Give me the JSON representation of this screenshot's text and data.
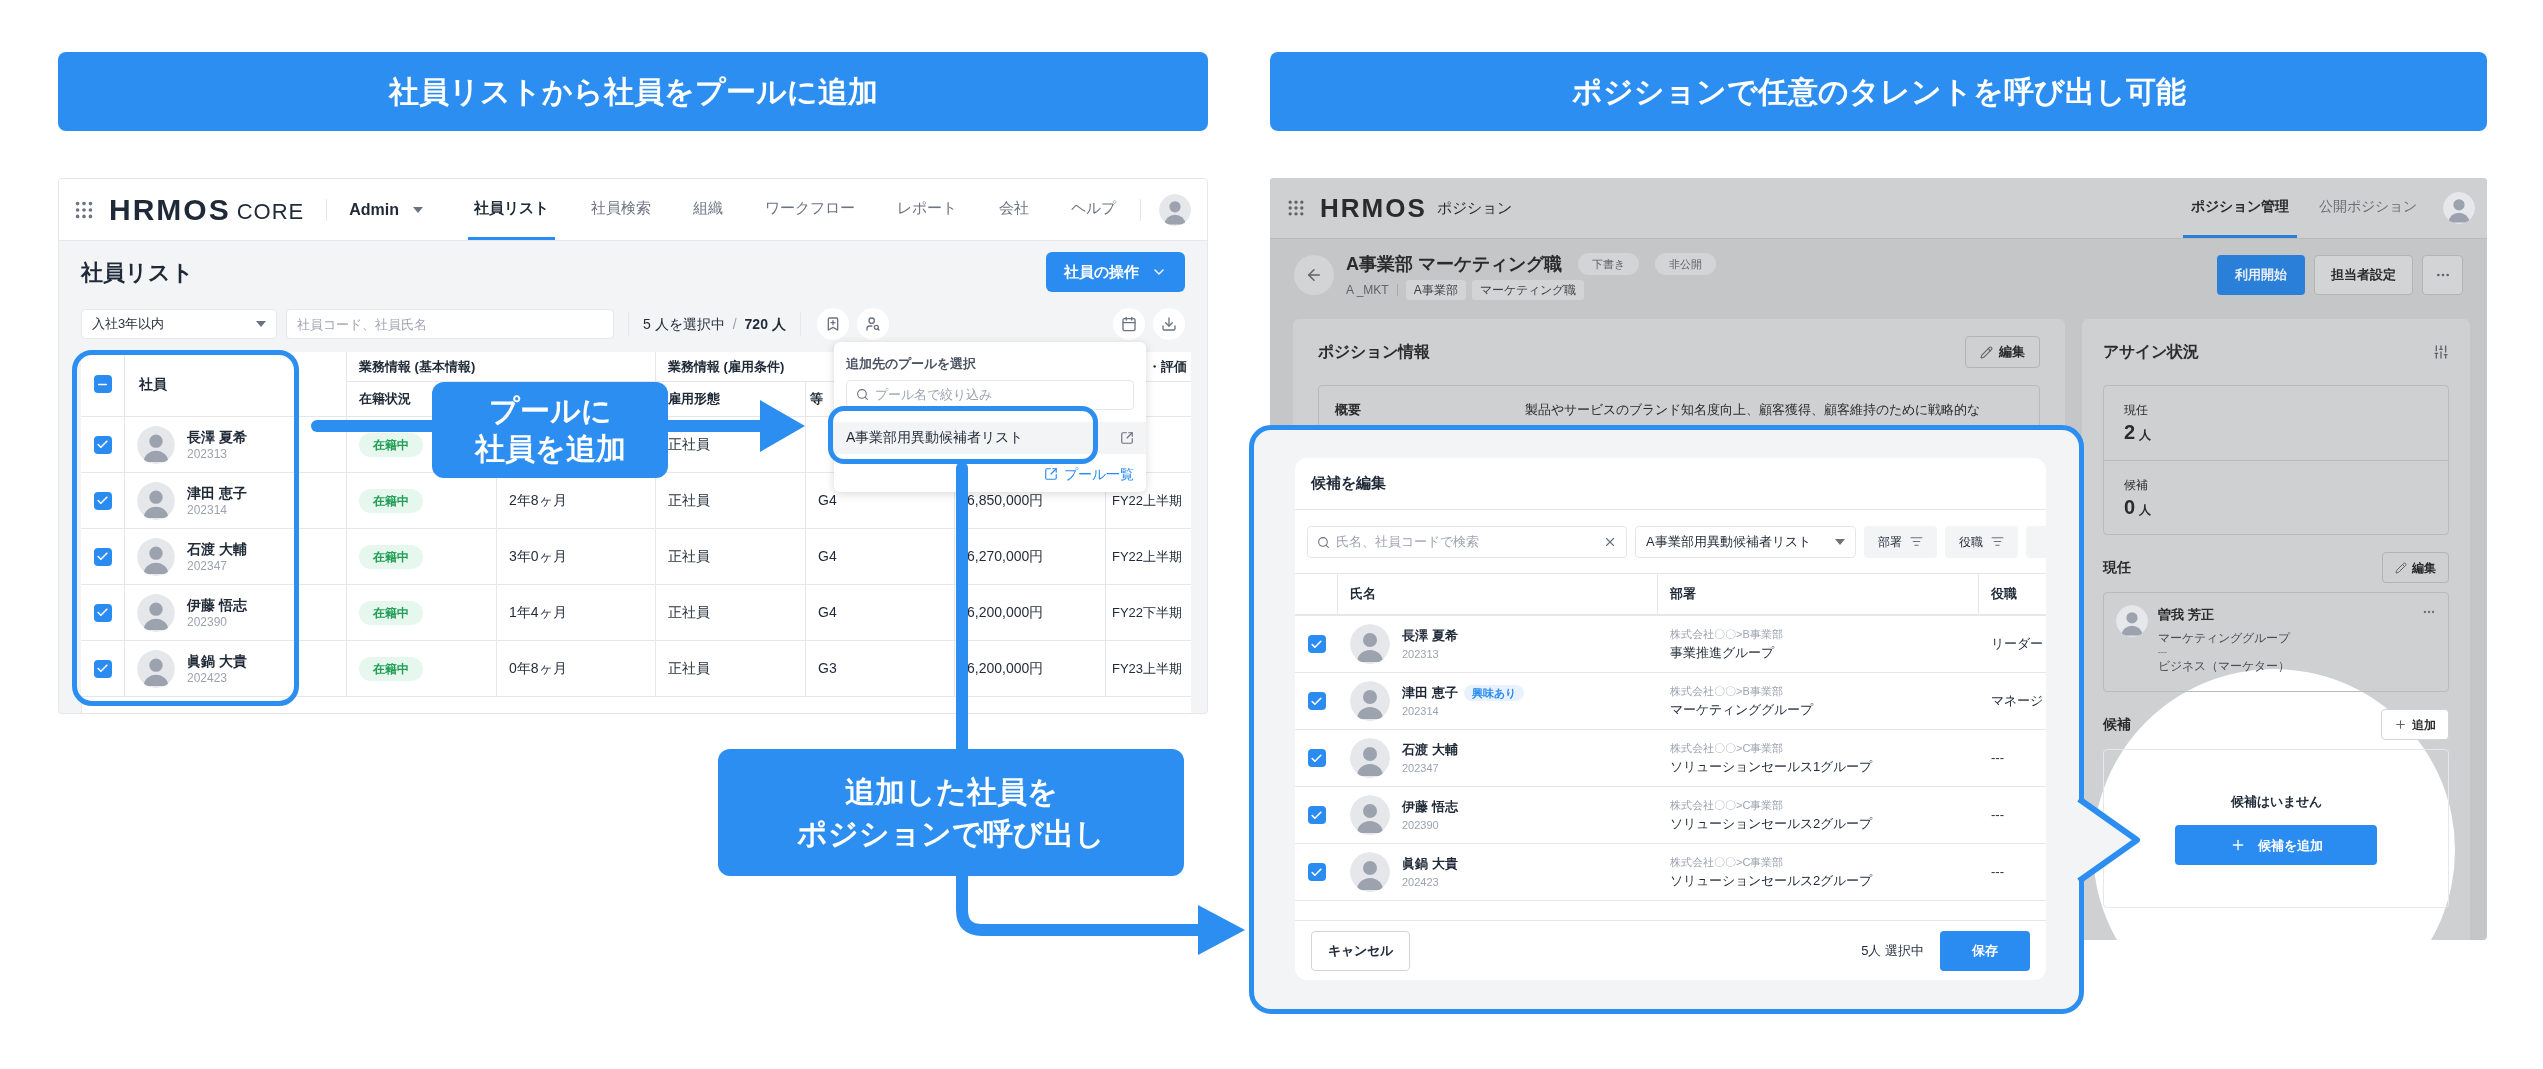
{
  "banners": [
    {
      "text": "社員リストから社員をプールに追加"
    },
    {
      "text": "ポジションで任意のタレントを呼び出し可能"
    }
  ],
  "left_app": {
    "nav": {
      "logo": "HRMOS",
      "logo_suffix": "CORE",
      "account": "Admin",
      "tabs": [
        {
          "label": "社員リスト",
          "selected": true
        },
        {
          "label": "社員検索",
          "selected": false
        },
        {
          "label": "組織",
          "selected": false
        },
        {
          "label": "ワークフロー",
          "selected": false
        },
        {
          "label": "レポート",
          "selected": false
        },
        {
          "label": "会社",
          "selected": false
        },
        {
          "label": "ヘルプ",
          "selected": false
        }
      ]
    },
    "page_title": "社員リスト",
    "action_button": "社員の操作",
    "filter": {
      "value": "入社3年以内"
    },
    "search": {
      "placeholder": "社員コード、社員氏名"
    },
    "selection": {
      "selected": "5 人を選択中",
      "separator": "/",
      "total": "720 人"
    },
    "table": {
      "select_all": {
        "indeterminate": true
      },
      "groups": [
        "業務情報 (基本情報)",
        "業務情報 (雇用条件)",
        "・評価"
      ],
      "columns": {
        "employee": "社員",
        "status": "在籍状況",
        "employment_type": "雇用形態",
        "column_6": "等"
      },
      "rows": [
        {
          "checked": true,
          "name": "長澤 夏希",
          "code": "202313",
          "status": "在籍中",
          "employment_type": "正社員"
        },
        {
          "checked": true,
          "name": "津田 恵子",
          "code": "202314",
          "status": "在籍中",
          "tenure": "2年8ヶ月",
          "employment_type": "正社員",
          "grade": "G4",
          "salary": "6,850,000円",
          "column_8": "FY22上半期"
        },
        {
          "checked": true,
          "name": "石渡 大輔",
          "code": "202347",
          "status": "在籍中",
          "tenure": "3年0ヶ月",
          "employment_type": "正社員",
          "grade": "G4",
          "salary": "6,270,000円",
          "column_8": "FY22上半期"
        },
        {
          "checked": true,
          "name": "伊藤 悟志",
          "code": "202390",
          "status": "在籍中",
          "tenure": "1年4ヶ月",
          "employment_type": "正社員",
          "grade": "G4",
          "salary": "6,200,000円",
          "column_8": "FY22下半期"
        },
        {
          "checked": true,
          "name": "眞鍋 大貴",
          "code": "202423",
          "status": "在籍中",
          "tenure": "0年8ヶ月",
          "employment_type": "正社員",
          "grade": "G3",
          "salary": "6,200,000円",
          "column_8": "FY23上半期"
        }
      ]
    },
    "pool_menu": {
      "title": "追加先のプールを選択",
      "search_placeholder": "プール名で絞り込み",
      "items": [
        {
          "label": "A事業部用異動候補者リスト",
          "highlighted": true
        }
      ],
      "link": "プール一覧"
    }
  },
  "callouts": [
    {
      "lines": [
        "プールに",
        "社員を追加"
      ]
    },
    {
      "lines": [
        "追加した社員を",
        "ポジションで呼び出し"
      ]
    }
  ],
  "right_app": {
    "nav": {
      "logo": "HRMOS",
      "product": "ポジション",
      "tabs": [
        {
          "label": "ポジション管理",
          "selected": true
        },
        {
          "label": "公開ポジション",
          "selected": false
        }
      ]
    },
    "position": {
      "title": "A事業部 マーケティング職",
      "code": "A _MKT",
      "tags": [
        "A事業部",
        "マーケティング職"
      ],
      "badges": [
        "下書き",
        "非公開"
      ]
    },
    "buttons": {
      "primary": "利用開始",
      "secondary": "担当者設定"
    },
    "info_panel": {
      "title": "ポジション情報",
      "edit": "編集",
      "rows": [
        {
          "label": "概要",
          "value": "製品やサービスのブランド知名度向上、顧客獲得、顧客維持のために戦略的な"
        }
      ]
    },
    "assign_panel": {
      "title": "アサイン状況",
      "stats": [
        {
          "label": "現任",
          "count": "2",
          "unit": "人"
        },
        {
          "label": "候補",
          "count": "0",
          "unit": "人"
        }
      ],
      "current": {
        "title": "現任",
        "edit": "編集",
        "people": [
          {
            "name": "曽我 芳正",
            "group": "マーケティンググループ",
            "line_2": "---",
            "role": "ビジネス（マーケター）"
          }
        ]
      },
      "candidates": {
        "title": "候補",
        "add": "追加",
        "empty": "候補はいません",
        "add_button": "候補を追加"
      }
    }
  },
  "candidate_modal": {
    "title": "候補を編集",
    "search_placeholder": "氏名、社員コードで検索",
    "pool_select": "A事業部用異動候補者リスト",
    "filters": [
      "部署",
      "役職"
    ],
    "columns": [
      "氏名",
      "部署",
      "役職"
    ],
    "rows": [
      {
        "checked": true,
        "name": "長澤 夏希",
        "code": "202313",
        "org": "株式会社〇〇>B事業部",
        "group": "事業推進グループ",
        "role": "リーダー"
      },
      {
        "checked": true,
        "name": "津田 恵子",
        "code": "202314",
        "tag": "興味あり",
        "org": "株式会社〇〇>B事業部",
        "group": "マーケティンググループ",
        "role": "マネージ"
      },
      {
        "checked": true,
        "name": "石渡 大輔",
        "code": "202347",
        "org": "株式会社〇〇>C事業部",
        "group": "ソリューションセールス1グループ",
        "role": "---"
      },
      {
        "checked": true,
        "name": "伊藤 悟志",
        "code": "202390",
        "org": "株式会社〇〇>C事業部",
        "group": "ソリューションセールス2グループ",
        "role": "---"
      },
      {
        "checked": true,
        "name": "眞鍋 大貴",
        "code": "202423",
        "org": "株式会社〇〇>C事業部",
        "group": "ソリューションセールス2グループ",
        "role": "---"
      }
    ],
    "cancel": "キャンセル",
    "selected_count": "5人 選択中",
    "save": "保存"
  }
}
